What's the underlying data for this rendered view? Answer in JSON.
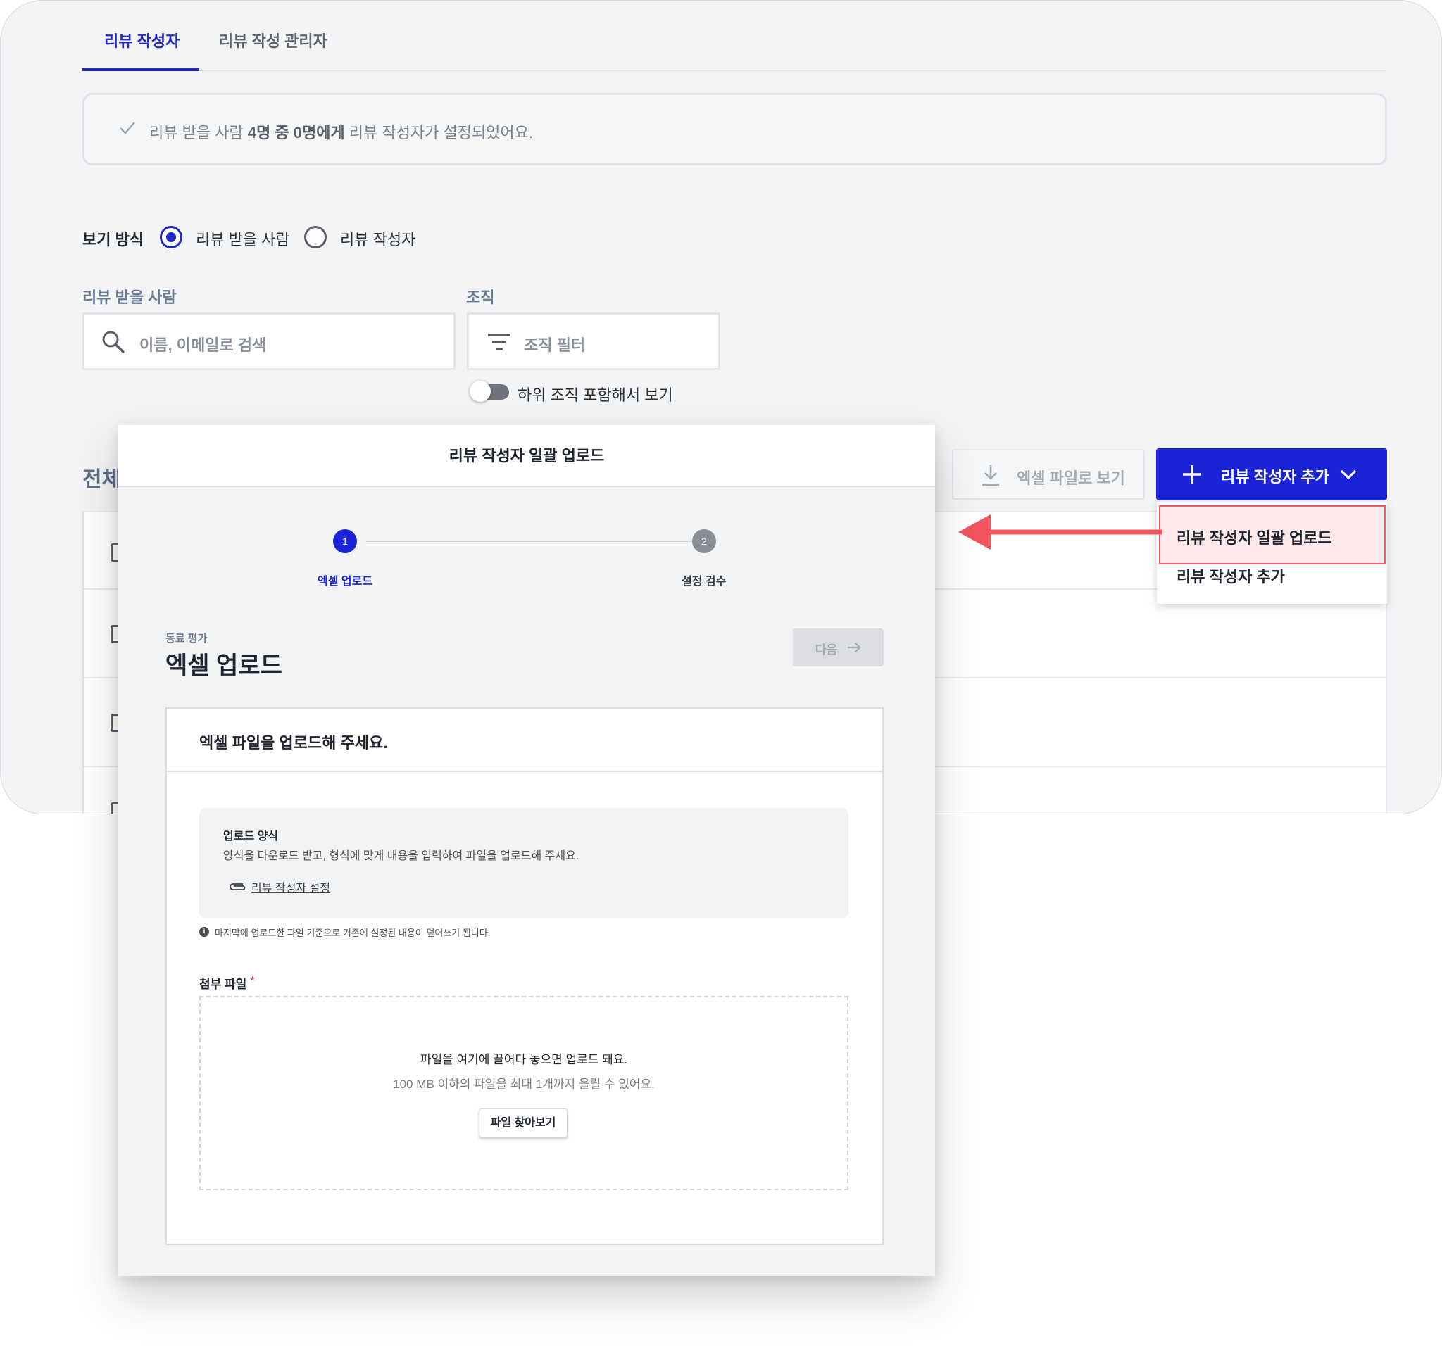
{
  "tabs": [
    {
      "label": "리뷰 작성자",
      "active": true
    },
    {
      "label": "리뷰 작성 관리자",
      "active": false
    }
  ],
  "notice": {
    "prefix": "리뷰 받을 사람 ",
    "bold": "4명 중 0명에게",
    "suffix": " 리뷰 작성자가 설정되었어요."
  },
  "view_mode": {
    "label": "보기 방식",
    "options": [
      {
        "label": "리뷰 받을 사람",
        "selected": true
      },
      {
        "label": "리뷰 작성자",
        "selected": false
      }
    ]
  },
  "filters": {
    "reviewee_label": "리뷰 받을 사람",
    "search_placeholder": "이름, 이메일로 검색",
    "org_label": "조직",
    "org_filter": "조직 필터",
    "include_sub_orgs": "하위 조직 포함해서 보기",
    "include_sub_orgs_on": false
  },
  "table": {
    "total_label": "전체"
  },
  "toolbar": {
    "excel_view": "엑셀 파일로 보기",
    "add_reviewer": "리뷰 작성자 추가"
  },
  "dropdown": {
    "items": [
      {
        "label": "리뷰 작성자 일괄 업로드",
        "highlighted": true
      },
      {
        "label": "리뷰 작성자 추가",
        "highlighted": false
      }
    ]
  },
  "modal": {
    "title": "리뷰 작성자 일괄 업로드",
    "steps": [
      {
        "number": "1",
        "label": "엑셀 업로드",
        "active": true
      },
      {
        "number": "2",
        "label": "설정 검수",
        "active": false
      }
    ],
    "sub_label": "동료 평가",
    "page_title": "엑셀 업로드",
    "next_label": "다음",
    "panel_title": "엑셀 파일을 업로드해 주세요.",
    "format_title": "업로드 양식",
    "format_desc": "양식을 다운로드 받고, 형식에 맞게 내용을 입력하여 파일을 업로드해 주세요.",
    "format_link": "리뷰 작성자 설정",
    "info_note": "마지막에 업로드한 파일 기준으로 기존에 설정된 내용이 덮어쓰기 됩니다.",
    "attach_label": "첨부 파일",
    "attach_required": "*",
    "dropzone_main": "파일을 여기에 끌어다 놓으면 업로드 돼요.",
    "dropzone_sub": "100 MB 이하의 파일을 최대 1개까지 올릴 수 있어요.",
    "browse_label": "파일 찾아보기"
  },
  "colors": {
    "primary": "#1a23d6",
    "highlight_border": "#ef5a64",
    "highlight_bg": "#fde9ea",
    "arrow": "#f0545d",
    "step_inactive": "#8a8d93"
  }
}
